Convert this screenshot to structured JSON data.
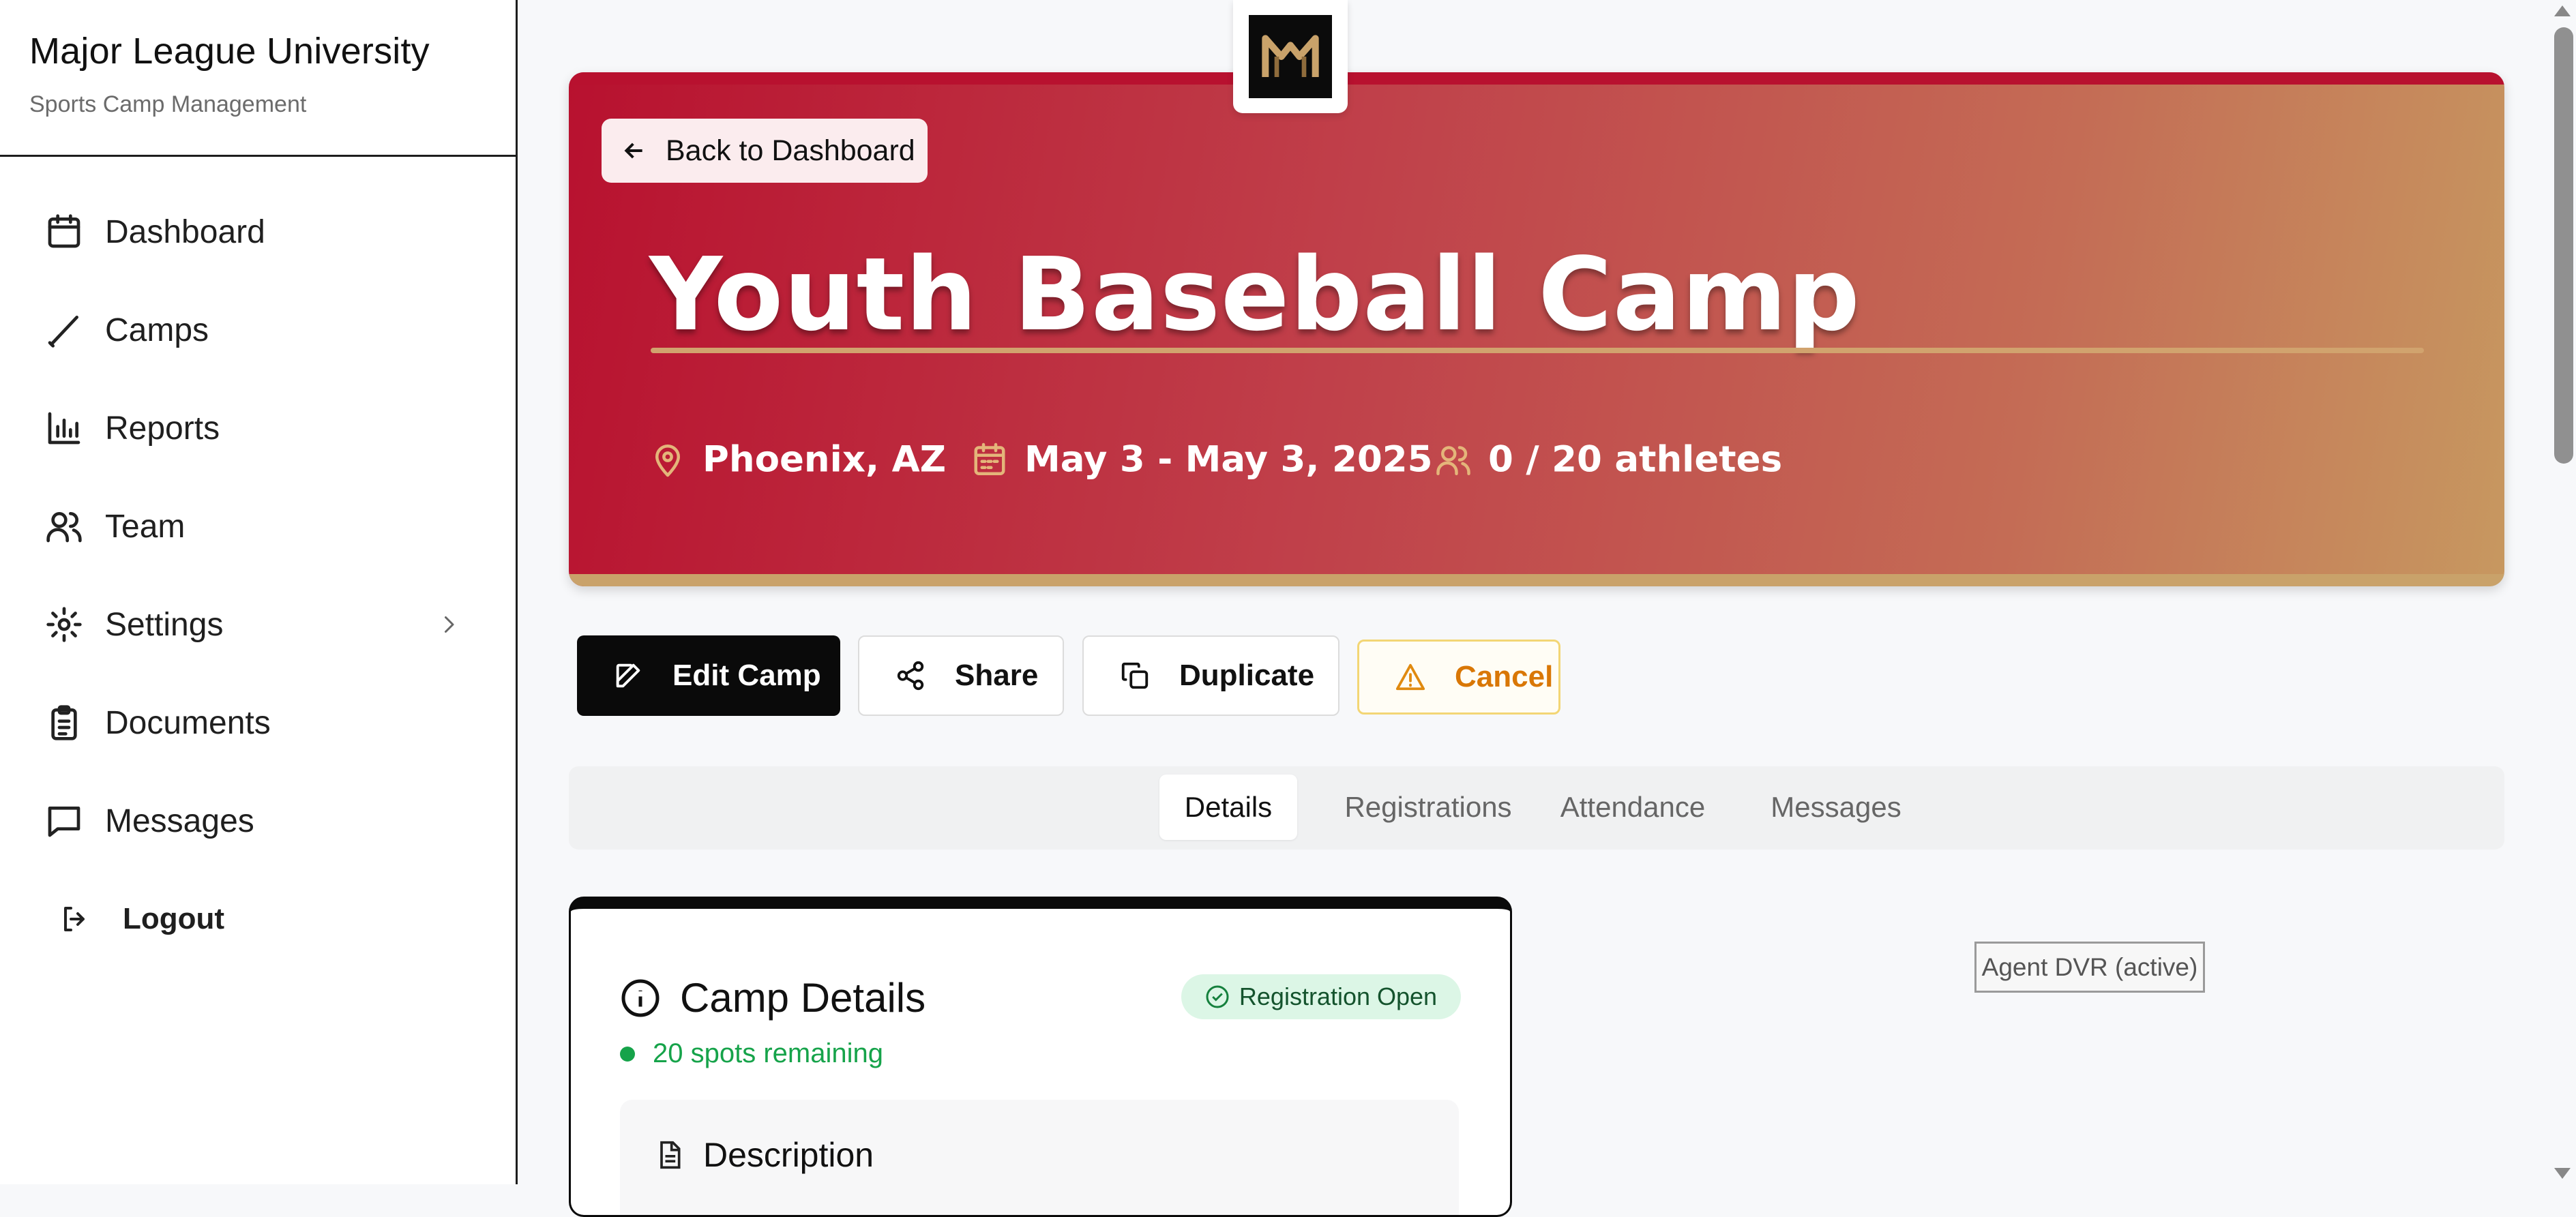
{
  "sidebar": {
    "brand_title": "Major League University",
    "brand_subtitle": "Sports Camp Management",
    "items": [
      {
        "label": "Dashboard",
        "icon": "calendar-icon"
      },
      {
        "label": "Camps",
        "icon": "bat-icon"
      },
      {
        "label": "Reports",
        "icon": "bar-chart-icon"
      },
      {
        "label": "Team",
        "icon": "users-icon"
      },
      {
        "label": "Settings",
        "icon": "gear-icon"
      },
      {
        "label": "Documents",
        "icon": "clipboard-icon"
      },
      {
        "label": "Messages",
        "icon": "message-icon"
      }
    ],
    "logout_label": "Logout"
  },
  "header": {
    "back_label": "Back to Dashboard",
    "title": "Youth Baseball Camp",
    "location": "Phoenix, AZ",
    "dates": "May 3 - May 3, 2025",
    "athletes": "0 / 20 athletes"
  },
  "actions": {
    "edit": "Edit Camp",
    "share": "Share",
    "duplicate": "Duplicate",
    "cancel": "Cancel"
  },
  "tabs": [
    {
      "label": "Details",
      "active": true
    },
    {
      "label": "Registrations",
      "active": false
    },
    {
      "label": "Attendance",
      "active": false
    },
    {
      "label": "Messages",
      "active": false
    }
  ],
  "details": {
    "title": "Camp Details",
    "badge": "Registration Open",
    "spots": "20 spots remaining",
    "description_title": "Description"
  },
  "agent_tag": "Agent DVR (active)",
  "colors": {
    "brand_red": "#b8112f",
    "brand_gold": "#c9a26a",
    "success": "#16a34a",
    "warning": "#d97706"
  }
}
